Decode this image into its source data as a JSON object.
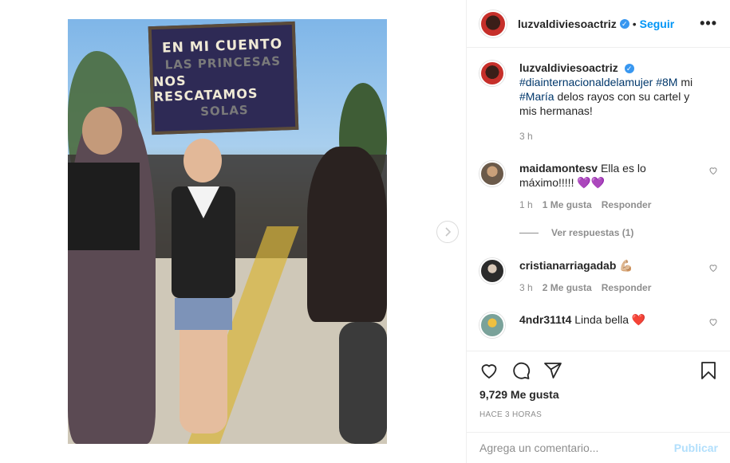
{
  "post": {
    "photo_sign": {
      "line1": "EN MI CUENTO",
      "line2": "LAS PRINCESAS",
      "line3": "NOS RESCATAMOS",
      "line4": "SOLAS"
    }
  },
  "header": {
    "username": "luzvaldiviesoactriz",
    "separator": "•",
    "follow_label": "Seguir",
    "more_label": "•••"
  },
  "caption": {
    "username": "luzvaldiviesoactriz",
    "tag1": "#diainternacionaldelamujer",
    "tag2": "#8M",
    "text1": "mi",
    "tag3": "#María",
    "text2": "delos rayos con su cartel y mis hermanas!",
    "time": "3 h"
  },
  "comments": [
    {
      "username": "maidamontesv",
      "text": "Ella es lo máximo!!!!! 💜💜",
      "time": "1 h",
      "likes": "1 Me gusta",
      "reply": "Responder",
      "view_replies": "Ver respuestas (1)"
    },
    {
      "username": "cristianarriagadab",
      "text": "💪🏼",
      "time": "3 h",
      "likes": "2 Me gusta",
      "reply": "Responder"
    },
    {
      "username": "4ndr311t4",
      "text": "Linda bella ❤️"
    }
  ],
  "actions": {
    "likes": "9,729 Me gusta",
    "posted": "Hace 3 horas"
  },
  "add_comment": {
    "placeholder": "Agrega un comentario...",
    "publish": "Publicar"
  },
  "colors": {
    "link": "#0095f6",
    "tag": "#00376b",
    "muted": "#8e8e8e",
    "publish_disabled": "#b2dffc"
  },
  "icons": [
    "chevron-right-icon",
    "verified-icon",
    "heart-icon",
    "comment-icon",
    "share-icon",
    "bookmark-icon"
  ]
}
